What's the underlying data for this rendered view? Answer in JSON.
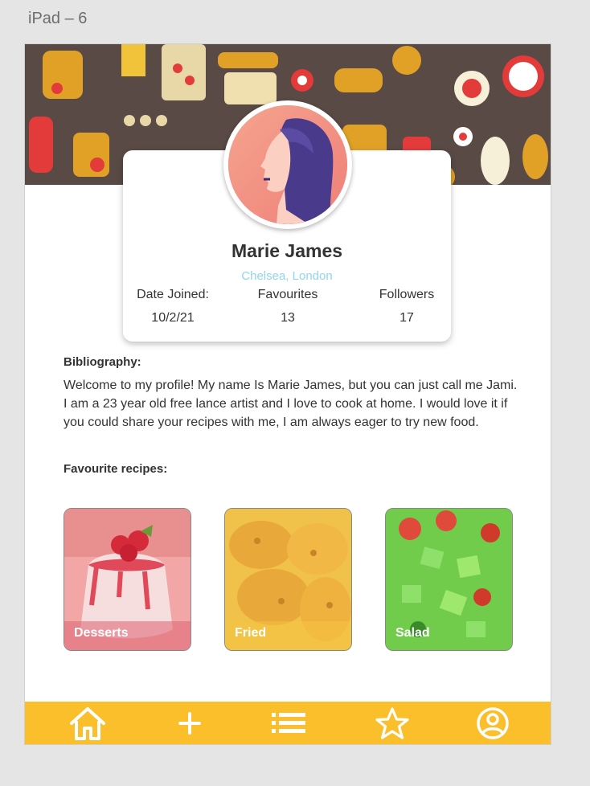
{
  "artboard": {
    "label": "iPad – 6"
  },
  "profile": {
    "name": "Marie James",
    "location": "Chelsea, London",
    "stats": [
      {
        "label": "Date Joined:",
        "value": "10/2/21"
      },
      {
        "label": "Favourites",
        "value": "13"
      },
      {
        "label": "Followers",
        "value": "17"
      }
    ]
  },
  "bio": {
    "heading": "Bibliography:",
    "text": "Welcome to my profile! My name Is Marie James, but you can just call me Jami. I am a 23 year old free lance artist and I love to cook at home. I would love it if you could share your recipes with me, I am always eager to try new food."
  },
  "favourites": {
    "heading": "Favourite recipes:",
    "items": [
      {
        "label": "Desserts"
      },
      {
        "label": "Fried"
      },
      {
        "label": "Salad"
      }
    ]
  },
  "nav": {
    "items": [
      "home-icon",
      "plus-icon",
      "list-icon",
      "star-icon",
      "account-icon"
    ]
  },
  "colors": {
    "accent": "#fbbf2c",
    "location": "#8fd6f0",
    "banner": "#5a4a45"
  }
}
